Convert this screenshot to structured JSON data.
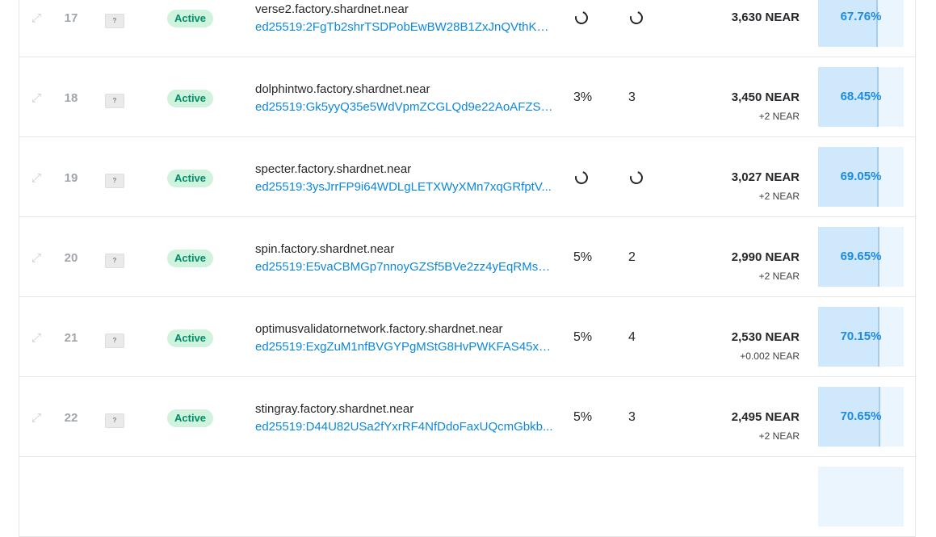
{
  "validators": [
    {
      "order": "17",
      "badge": "?",
      "status": "Active",
      "account": "verse2.factory.shardnet.near",
      "key": "ed25519:2FgTb2shrTSDPobEwBW28B1ZxJnQVthKQ...",
      "fee": null,
      "delegators": null,
      "stake": "3,630 NEAR",
      "stake_delta": "",
      "cumulative": "67.76%",
      "cumulative_pct": 67.76
    },
    {
      "order": "18",
      "badge": "?",
      "status": "Active",
      "account": "dolphintwo.factory.shardnet.near",
      "key": "ed25519:Gk5yyQ35e5WdVpmZCGLQd9e22AoAFZS7...",
      "fee": "3%",
      "delegators": "3",
      "stake": "3,450 NEAR",
      "stake_delta": "+2 NEAR",
      "cumulative": "68.45%",
      "cumulative_pct": 68.45
    },
    {
      "order": "19",
      "badge": "?",
      "status": "Active",
      "account": "specter.factory.shardnet.near",
      "key": "ed25519:3ysJrrFP9i64WDLgLETXWyXMn7xqGRfptV...",
      "fee": null,
      "delegators": null,
      "stake": "3,027 NEAR",
      "stake_delta": "+2 NEAR",
      "cumulative": "69.05%",
      "cumulative_pct": 69.05
    },
    {
      "order": "20",
      "badge": "?",
      "status": "Active",
      "account": "spin.factory.shardnet.near",
      "key": "ed25519:E5vaCBMGp7nnoyGZSf5BVe2zz4yEqRMsS...",
      "fee": "5%",
      "delegators": "2",
      "stake": "2,990 NEAR",
      "stake_delta": "+2 NEAR",
      "cumulative": "69.65%",
      "cumulative_pct": 69.65
    },
    {
      "order": "21",
      "badge": "?",
      "status": "Active",
      "account": "optimusvalidatornetwork.factory.shardnet.near",
      "key": "ed25519:ExgZuM1nfBVGYPgMStG8HvPWKFAS45xab...",
      "fee": "5%",
      "delegators": "4",
      "stake": "2,530 NEAR",
      "stake_delta": "+0.002 NEAR",
      "cumulative": "70.15%",
      "cumulative_pct": 70.15
    },
    {
      "order": "22",
      "badge": "?",
      "status": "Active",
      "account": "stingray.factory.shardnet.near",
      "key": "ed25519:D44U82USa2fYxrRF4NfDdoFaxUQcmGbkb...",
      "fee": "5%",
      "delegators": "3",
      "stake": "2,495 NEAR",
      "stake_delta": "+2 NEAR",
      "cumulative": "70.65%",
      "cumulative_pct": 70.65
    }
  ],
  "icons": {
    "expand": "expand-arrows-icon",
    "loading": "loading-spinner-icon"
  },
  "colors": {
    "active_bg": "#cff3dd",
    "active_text": "#008d6a",
    "link": "#0d88dc",
    "cumulative_fill": "#d0e8fc",
    "cumulative_bg": "#eaf5fe"
  }
}
